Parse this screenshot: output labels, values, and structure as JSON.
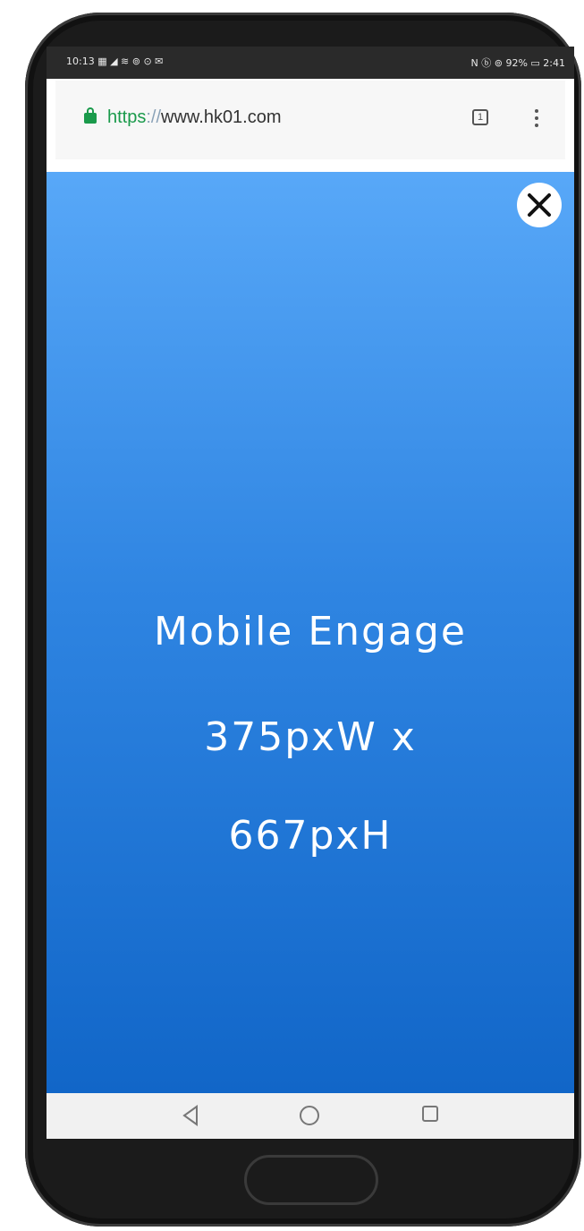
{
  "statusbar": {
    "left": "10:13 ▦  ◢ ≋ ⊚ ⊙ ✉",
    "right": "N ⓑ ⊚ 92% ▭ 2:41"
  },
  "browser": {
    "url_scheme": "https",
    "url_sep": "://",
    "url_host": "www.hk01.com",
    "tab_count": "1"
  },
  "ad": {
    "line1": "Mobile Engage",
    "line2": "375pxW x",
    "line3": "667pxH",
    "colors": {
      "top": "#58a8f8",
      "bottom": "#1166c8"
    }
  },
  "icons": {
    "lock": "lock-icon",
    "close": "close-icon",
    "tabs": "tab-switcher-icon",
    "menu": "kebab-menu-icon",
    "back": "back-triangle-icon",
    "home": "home-circle-icon",
    "recent": "recent-apps-icon"
  }
}
